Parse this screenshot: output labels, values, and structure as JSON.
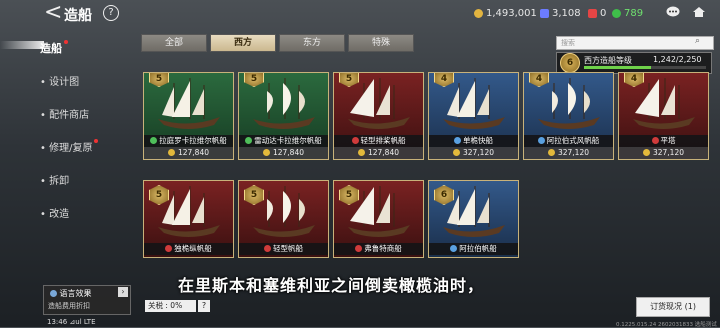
{
  "header": {
    "back_glyph": "<",
    "title": "造船",
    "help_glyph": "?",
    "gold": "1,493,001",
    "gem": "3,108",
    "ticket": "0",
    "energy": "789"
  },
  "sidebar": {
    "items": [
      {
        "label": "造船"
      },
      {
        "label": "设计图"
      },
      {
        "label": "配件商店"
      },
      {
        "label": "修理/复原"
      },
      {
        "label": "拆卸"
      },
      {
        "label": "改造"
      }
    ]
  },
  "tabs": [
    {
      "label": "全部"
    },
    {
      "label": "西方"
    },
    {
      "label": "东方"
    },
    {
      "label": "特殊"
    }
  ],
  "search": {
    "placeholder": "搜索"
  },
  "level": {
    "badge": "6",
    "label": "西方造船等级",
    "value": "1,242/2,250",
    "progress": 0.552
  },
  "ships": [
    {
      "level": "5",
      "name": "拉庭罗卡拉维尔帆船",
      "price": "127,840",
      "bg": "green"
    },
    {
      "level": "5",
      "name": "雷动达卡拉维尔帆船",
      "price": "127,840",
      "bg": "green"
    },
    {
      "level": "5",
      "name": "轻型排桨帆船",
      "price": "127,840",
      "bg": "red"
    },
    {
      "level": "4",
      "name": "单桅快船",
      "price": "327,120",
      "bg": "blue"
    },
    {
      "level": "4",
      "name": "阿拉伯式风帆船",
      "price": "327,120",
      "bg": "blue"
    },
    {
      "level": "4",
      "name": "平塔",
      "price": "327,120",
      "bg": "red"
    },
    {
      "level": "5",
      "name": "独桅纵帆船",
      "price": "",
      "bg": "red"
    },
    {
      "level": "5",
      "name": "轻型帆船",
      "price": "",
      "bg": "red"
    },
    {
      "level": "5",
      "name": "弗鲁特商船",
      "price": "",
      "bg": "red"
    },
    {
      "level": "6",
      "name": "阿拉伯帆船",
      "price": "",
      "bg": "blue"
    }
  ],
  "subtitle": "在里斯本和塞维利亚之间倒卖橄榄油时，",
  "language_effect": {
    "title": "语言效果",
    "desc": "造船费用折扣"
  },
  "tax": {
    "label": "关税 : 0%",
    "help": "?"
  },
  "order_button": "订货现况 (1)",
  "status_bar": "13:46 ⊿ul LTE",
  "version": "0.1225.015.24 2602031833 选船测试",
  "colors": {
    "accent": "#cbb88f",
    "progress": "#6fd24a",
    "reddot": "#e33333"
  }
}
